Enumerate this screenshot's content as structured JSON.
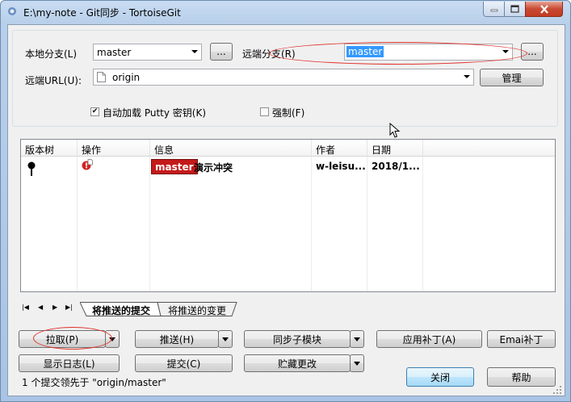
{
  "window": {
    "title": "E:\\my-note - Git同步 - TortoiseGit"
  },
  "local_branch": {
    "label": "本地分支(L)",
    "value": "master",
    "browse_label": "..."
  },
  "remote_branch": {
    "label": "远端分支(R)",
    "value": "master",
    "browse_label": "..."
  },
  "remote_url": {
    "label": "远端URL(U):",
    "value": "origin",
    "manage_label": "管理"
  },
  "options": {
    "autoload_putty": {
      "label": "自动加载 Putty 密钥(K)",
      "checked": true
    },
    "force": {
      "label": "强制(F)",
      "checked": false
    }
  },
  "table": {
    "columns": [
      "版本树",
      "操作",
      "信息",
      "作者",
      "日期"
    ],
    "rows": [
      {
        "branch_badge": "master",
        "message": "演示冲突",
        "author": "w-leisu...",
        "date": "2018/1..."
      }
    ]
  },
  "tabs": {
    "nav": [
      "|◀",
      "◀",
      "▶",
      "▶|"
    ],
    "items": [
      "将推送的提交",
      "将推送的变更"
    ],
    "active": 0
  },
  "buttons": {
    "pull": "拉取(P)",
    "push": "推送(H)",
    "submodule": "同步子模块",
    "apply_patch": "应用补丁(A)",
    "email_patch": "Emai补丁",
    "show_log": "显示日志(L)",
    "commit": "提交(C)",
    "stash": "贮藏更改",
    "close": "关闭",
    "help": "帮助"
  },
  "status": {
    "text": "1 个提交领先于 \"origin/master\""
  },
  "colors": {
    "badge_bg": "#c41a1a",
    "annotation": "#e0302a",
    "selection": "#3399ff"
  }
}
